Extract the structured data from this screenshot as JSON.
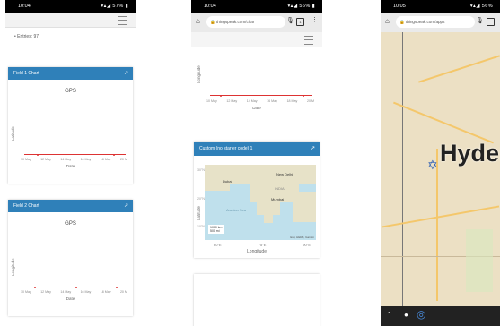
{
  "phone1": {
    "time": "10:04",
    "status_right": "57%",
    "bullets": [
      "Entries: 97"
    ],
    "field1": {
      "header": "Field 1 Chart",
      "title": "GPS",
      "ylabel": "Latitude",
      "xlabel": "Date",
      "ticks": [
        "10 May",
        "12 May",
        "14 May",
        "16 May",
        "18 May",
        "20 M"
      ]
    },
    "field2": {
      "header": "Field 2 Chart",
      "title": "GPS",
      "ylabel": "Longitude",
      "xlabel": "Date",
      "ticks": [
        "10 May",
        "12 May",
        "14 May",
        "16 May",
        "18 May",
        "20 M"
      ]
    }
  },
  "phone2": {
    "time": "10:04",
    "status_right": "56%",
    "url": "thingspeak.com/char",
    "tabs_count": "1",
    "top_chart": {
      "ylabel": "Longitude",
      "xlabel": "Date",
      "ticks": [
        "10 May",
        "12 May",
        "14 May",
        "16 May",
        "18 May",
        "20 M"
      ]
    },
    "custom": {
      "header": "Custom (no starter code) 1",
      "ylabel": "Latitude",
      "xlabel": "Longitude",
      "yticks": [
        "30°N",
        "20°N",
        "10°N"
      ],
      "xticks": [
        "60°E",
        "75°E",
        "90°E"
      ],
      "places": [
        "New Delhi",
        "Dubai",
        "INDIA",
        "Mumbai",
        "Arabian Sea"
      ],
      "scale": [
        "1000 km",
        "500 mi"
      ],
      "attribution": "Esri, HERE, Garmin"
    }
  },
  "phone3": {
    "time": "10:05",
    "status_right": "56%",
    "url": "thingspeak.com/apps",
    "city": "Hyder"
  },
  "colors": {
    "card_header": "#2f80b9",
    "trace": "#dd3333",
    "status_bar": "#000000"
  }
}
